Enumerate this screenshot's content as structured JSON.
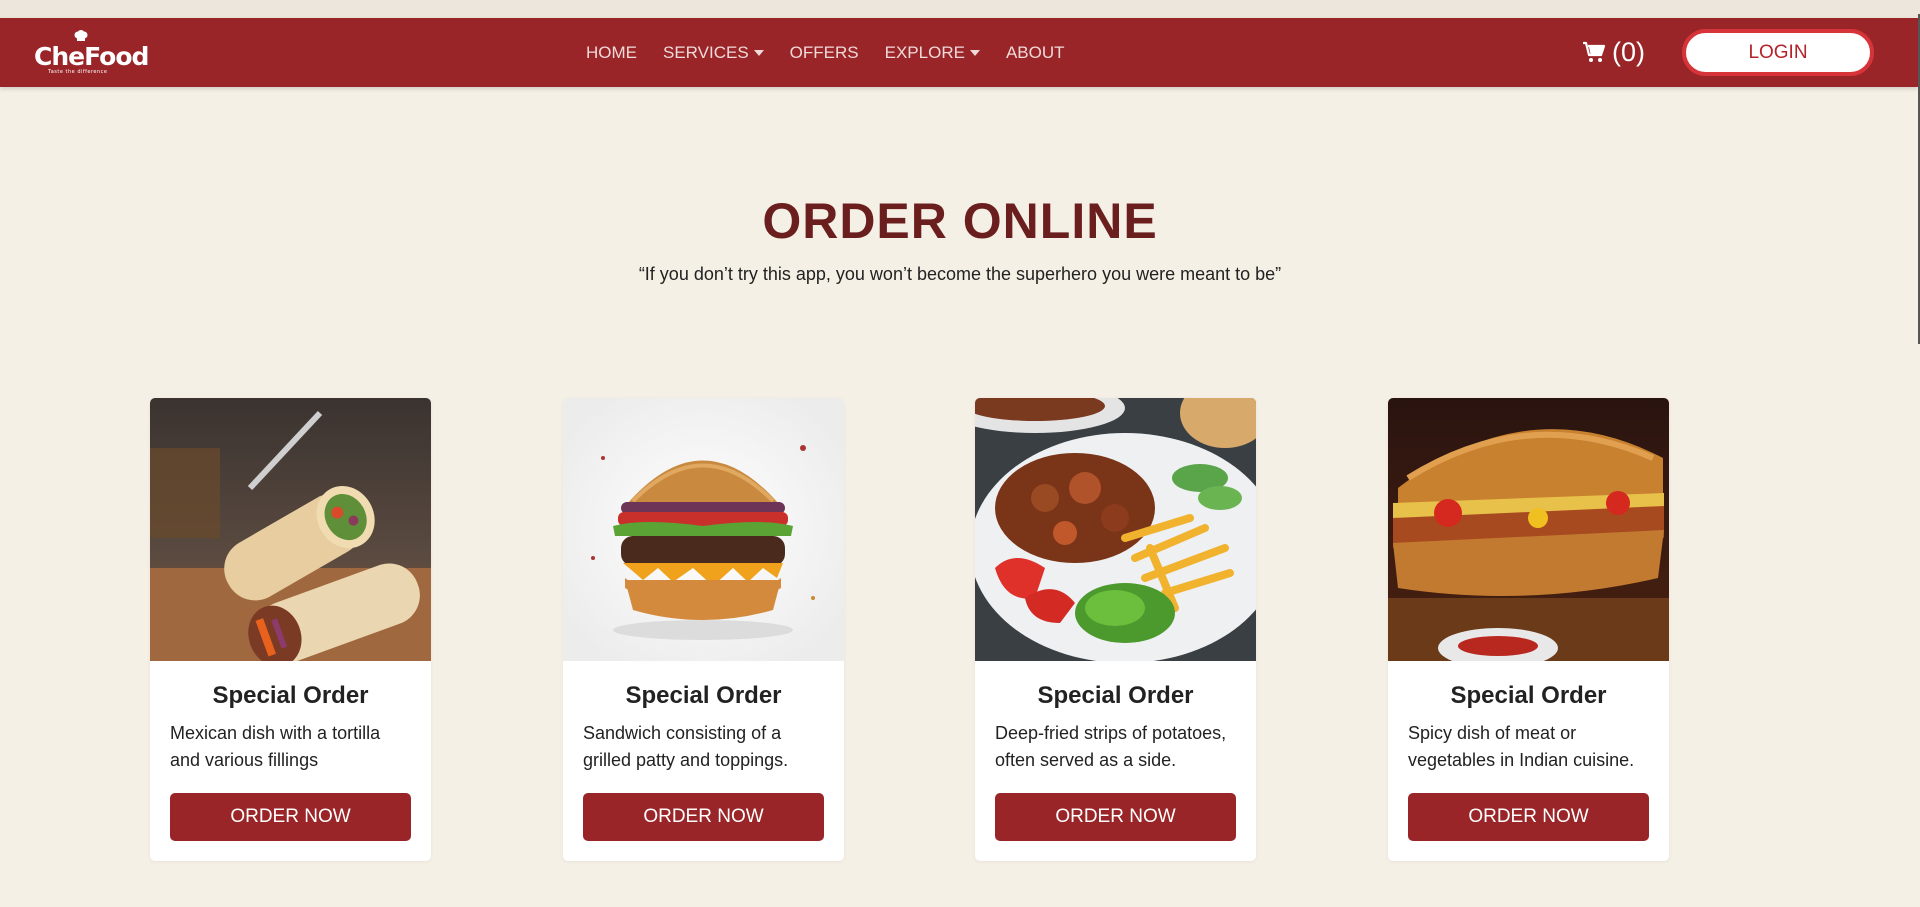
{
  "brand": {
    "name": "CheFood",
    "tagline": "Taste the difference"
  },
  "nav": {
    "links": [
      {
        "label": "HOME",
        "dropdown": false
      },
      {
        "label": "SERVICES",
        "dropdown": true
      },
      {
        "label": "OFFERS",
        "dropdown": false
      },
      {
        "label": "EXPLORE",
        "dropdown": true
      },
      {
        "label": "ABOUT",
        "dropdown": false
      }
    ],
    "cart_count": "(0)",
    "login_label": "LOGIN"
  },
  "hero": {
    "title": "ORDER ONLINE",
    "quote": "“If you don’t try this app, you won’t become the superhero you were meant to be”"
  },
  "cards": [
    {
      "title": "Special Order",
      "description": "Mexican dish with a tortilla and various fillings",
      "button": "ORDER NOW",
      "image": "burrito-image"
    },
    {
      "title": "Special Order",
      "description": "Sandwich consisting of a grilled patty and toppings.",
      "button": "ORDER NOW",
      "image": "burger-image"
    },
    {
      "title": "Special Order",
      "description": "Deep-fried strips of potatoes, often served as a side.",
      "button": "ORDER NOW",
      "image": "kebab-plate-image"
    },
    {
      "title": "Special Order",
      "description": "Spicy dish of meat or vegetables in Indian cuisine.",
      "button": "ORDER NOW",
      "image": "sub-sandwich-image"
    }
  ],
  "colors": {
    "primary": "#9a2528",
    "background": "#f5f0e6",
    "title": "#6b1e1e",
    "login_border": "#d7343a"
  },
  "icons": {
    "cart": "cart-icon",
    "chef_hat": "chef-hat-icon",
    "caret": "caret-down-icon"
  }
}
